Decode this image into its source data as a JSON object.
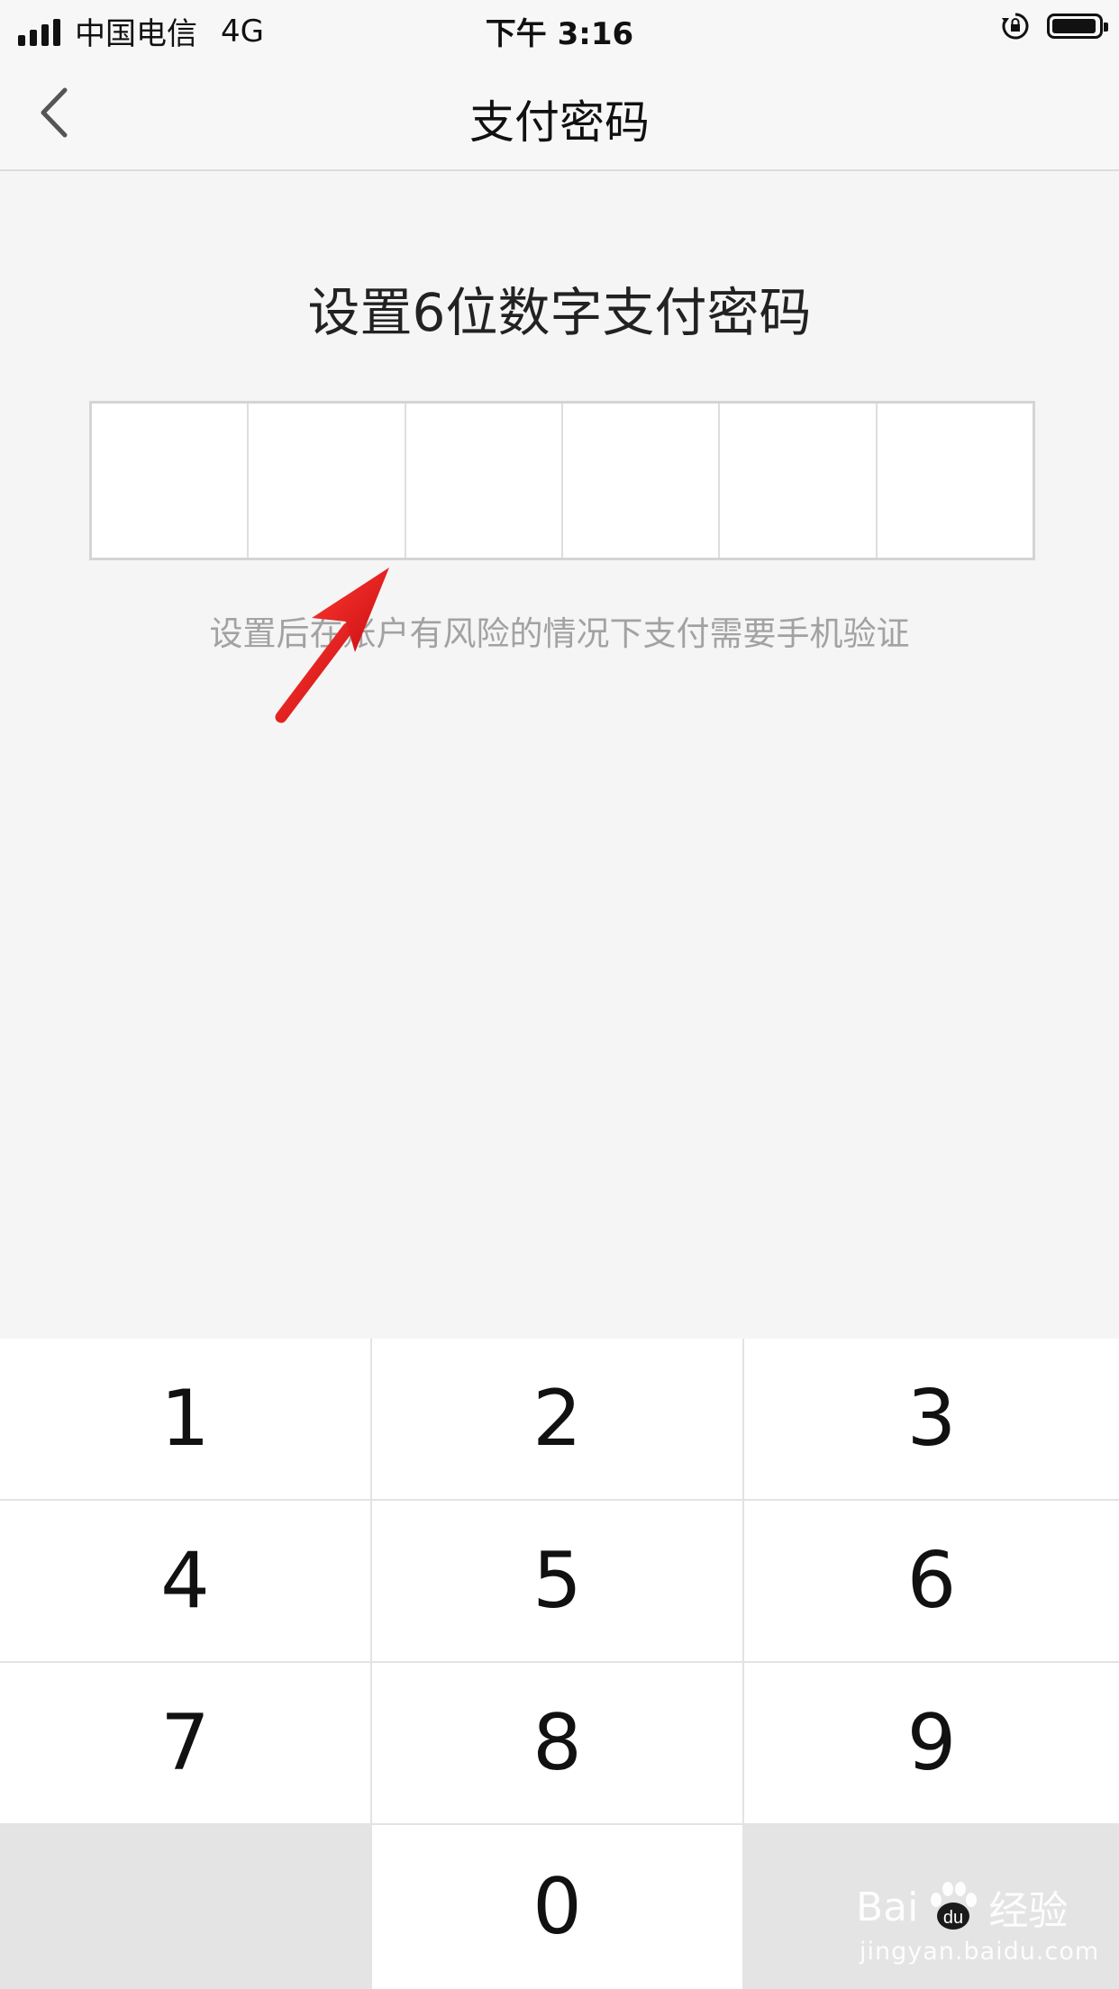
{
  "status_bar": {
    "carrier": "中国电信",
    "network": "4G",
    "time": "下午 3:16",
    "icons": [
      "signal-icon",
      "orientation-lock-icon",
      "battery-icon"
    ]
  },
  "nav": {
    "back_icon": "chevron-left-icon",
    "title": "支付密码"
  },
  "content": {
    "prompt": "设置6位数字支付密码",
    "pin_length": 6,
    "pin_entered": 0,
    "hint": "设置后在账户有风险的情况下支付需要手机验证"
  },
  "keypad": {
    "keys": [
      "1",
      "2",
      "3",
      "4",
      "5",
      "6",
      "7",
      "8",
      "9",
      "",
      "0",
      ""
    ]
  },
  "watermark": {
    "logo_text": "Bai",
    "logo_text2": "经验",
    "url": "jingyan.baidu.com"
  },
  "colors": {
    "background": "#f5f5f5",
    "annotation_arrow": "#e8161b",
    "hint_text": "#a2a2a2"
  }
}
